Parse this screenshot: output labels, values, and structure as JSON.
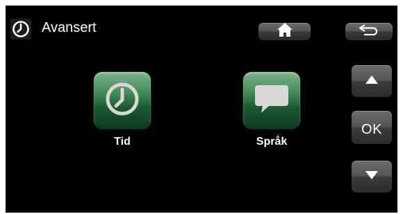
{
  "header": {
    "title": "Avansert",
    "title_icon": "clock-icon",
    "home_icon": "home-icon",
    "back_icon": "return-arrow-icon"
  },
  "menu": {
    "items": [
      {
        "label": "Tid",
        "icon": "clock-icon"
      },
      {
        "label": "Språk",
        "icon": "speech-bubble-icon"
      }
    ]
  },
  "nav": {
    "up_icon": "up-arrow-icon",
    "ok_label": "OK",
    "down_icon": "down-arrow-icon"
  },
  "colors": {
    "background": "#000000",
    "tile_green": "#2e7a47",
    "button_grey": "#555555",
    "text": "#ffffff"
  }
}
